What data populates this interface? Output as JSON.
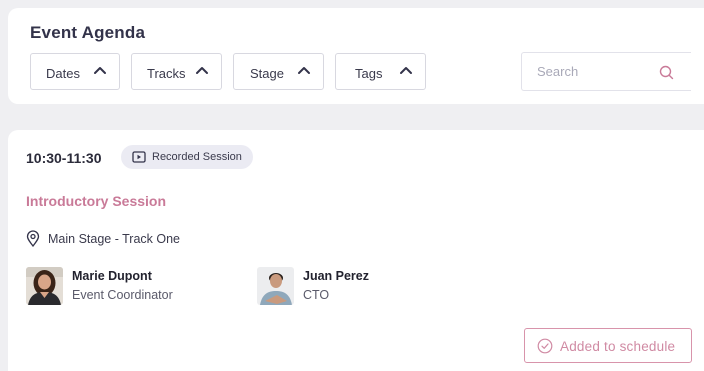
{
  "header": {
    "title": "Event Agenda",
    "filters": [
      {
        "label": "Dates",
        "icon": "chevron-up-icon"
      },
      {
        "label": "Tracks",
        "icon": "chevron-up-icon"
      },
      {
        "label": "Stage",
        "icon": "chevron-up-icon"
      },
      {
        "label": "Tags",
        "icon": "chevron-up-icon"
      }
    ],
    "search": {
      "value": "",
      "placeholder": "Search",
      "icon": "search-icon"
    }
  },
  "session": {
    "time": "10:30-11:30",
    "badge": {
      "label": "Recorded Session",
      "icon": "play-icon"
    },
    "title": "Introductory Session",
    "location": {
      "text": "Main Stage - Track One",
      "icon": "location-pin-icon"
    },
    "speakers": [
      {
        "name": "Marie Dupont",
        "role": "Event Coordinator"
      },
      {
        "name": "Juan Perez",
        "role": "CTO"
      }
    ],
    "schedule_button": {
      "label": "Added to schedule",
      "icon": "check-circle-icon"
    }
  },
  "colors": {
    "accent": "#c97a98",
    "badge_bg": "#ebebf3",
    "background": "#efeff2",
    "button_border": "#d894ab"
  }
}
